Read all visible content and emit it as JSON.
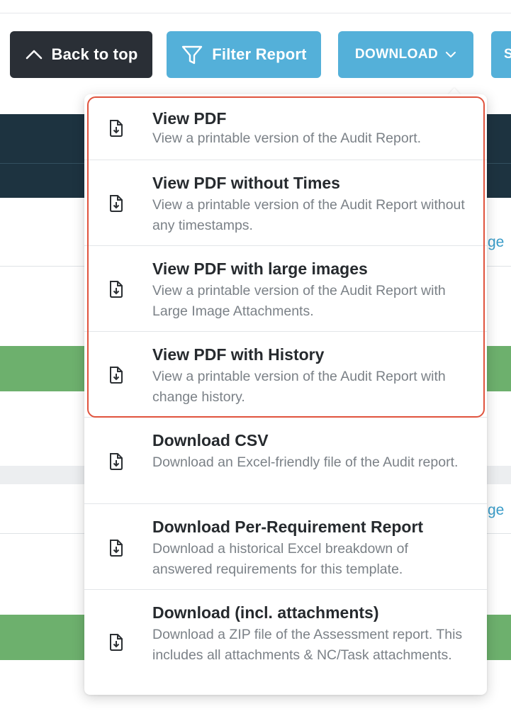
{
  "toolbar": {
    "back_to_top": "Back to top",
    "filter_report": "Filter Report",
    "download": "DOWNLOAD",
    "more_partial": "S"
  },
  "background": {
    "side_link_1": "ge",
    "side_link_2": "ge"
  },
  "dropdown": {
    "items": [
      {
        "title": "View PDF",
        "description": "View a printable version of the Audit Report.",
        "icon": "file-download-icon"
      },
      {
        "title": "View PDF without Times",
        "description": "View a printable version of the Audit Report without any timestamps.",
        "icon": "file-download-icon"
      },
      {
        "title": "View PDF with large images",
        "description": "View a printable version of the Audit Report with Large Image Attachments.",
        "icon": "file-download-icon"
      },
      {
        "title": "View PDF with History",
        "description": "View a printable version of the Audit Report with change history.",
        "icon": "file-download-icon"
      },
      {
        "title": "Download CSV",
        "description": "Download an Excel-friendly file of the Audit report.",
        "icon": "file-download-icon"
      },
      {
        "title": "Download Per-Requirement Report",
        "description": "Download a historical Excel breakdown of answered requirements for this template.",
        "icon": "file-download-icon"
      },
      {
        "title": "Download (incl. attachments)",
        "description": "Download a ZIP file of the Assessment report. This includes all attachments & NC/Task attachments.",
        "icon": "file-download-icon"
      }
    ],
    "highlight_color": "#e0533d"
  },
  "colors": {
    "dark_button": "#2a2f36",
    "accent_blue": "#54b0d9",
    "header_band": "#1d3340",
    "status_green": "#6db06d"
  }
}
